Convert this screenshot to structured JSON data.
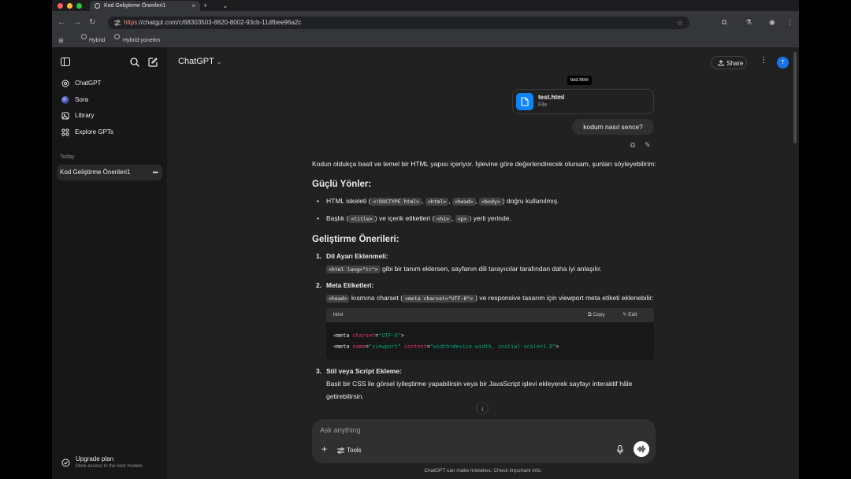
{
  "browser": {
    "tab_title": "Kod Geliştirme Önerileri1",
    "tab_close": "×",
    "new_tab": "+",
    "tab_menu": "⌄",
    "url_scheme": "https",
    "url_rest": "://chatgpt.com/c/68303503-8820-8002-93cb-11dfbee96a2c",
    "bookmarks": [
      {
        "label": "Hybrid"
      },
      {
        "label": "Hybrid-yonetim"
      }
    ]
  },
  "sidebar": {
    "items": [
      {
        "label": "ChatGPT",
        "icon": "chatgpt-logo-icon"
      },
      {
        "label": "Sora",
        "icon": "sora-icon"
      },
      {
        "label": "Library",
        "icon": "library-icon"
      },
      {
        "label": "Explore GPTs",
        "icon": "grid-icon"
      }
    ],
    "section_label": "Today",
    "history": [
      {
        "label": "Kod Geliştirme Önerileri1"
      }
    ],
    "upgrade_title": "Upgrade plan",
    "upgrade_subtitle": "More access to the best models"
  },
  "header": {
    "model_label": "ChatGPT",
    "share_label": "Share",
    "avatar_letter": "T"
  },
  "conversation": {
    "tooltip": "test.html",
    "file_name": "test.html",
    "file_type": "File",
    "user_message": "kodum nasıl sence?",
    "intro": "Kodun oldukça basit ve temel bir HTML yapısı içeriyor. İşlevine göre değerlendirecek olursam, şunları söyleyebilirim:",
    "strengths_title": "Güçlü Yönler:",
    "strength1_a": "HTML iskeleti (",
    "strength1_codes": [
      "<!DOCTYPE html>",
      "<html>",
      "<head>",
      "<body>"
    ],
    "strength1_b": ") doğru kullanılmış.",
    "strength2_a": "Başlık (",
    "strength2_code1": "<title>",
    "strength2_b": ") ve içerik etiketleri (",
    "strength2_code2": "<h1>",
    "strength2_code3": "<p>",
    "strength2_c": ") yerli yerinde.",
    "improvements_title": "Geliştirme Önerileri:",
    "item1_title": "Dil Ayarı Eklenmeli:",
    "item1_code": "<html lang=\"tr\">",
    "item1_text": " gibi bir tanım eklersen, sayfanın dili tarayıcılar tarafından daha iyi anlaşılır.",
    "item2_title": "Meta Etiketleri:",
    "item2_code1": "<head>",
    "item2_text1": " kısmına charset (",
    "item2_code2": "<meta charset=\"UTF-8\">",
    "item2_text2": ") ve responsive tasarım için viewport meta etiketi eklenebilir:",
    "codeblock": {
      "language": "html",
      "copy_label": "Copy",
      "edit_label": "Edit",
      "line1_tag": "<meta ",
      "line1_attr": "charset",
      "line1_eq": "=",
      "line1_val": "\"UTF-8\"",
      "line1_end": ">",
      "line2_tag": "<meta ",
      "line2_attr1": "name",
      "line2_val1": "\"viewport\"",
      "line2_attr2": "content",
      "line2_val2": "\"width=device-width, initial-scale=1.0\"",
      "line2_end": ">"
    },
    "item3_title": "Stil veya Script Ekleme:",
    "item3_text": "Basit bir CSS ile görsel iyileştirme yapabilirsin veya bir JavaScript işlevi ekleyerek sayfayı interaktif hâle getirebilirsin."
  },
  "composer": {
    "placeholder": "Ask anything",
    "tools_label": "Tools"
  },
  "footer": "ChatGPT can make mistakes. Check important info."
}
